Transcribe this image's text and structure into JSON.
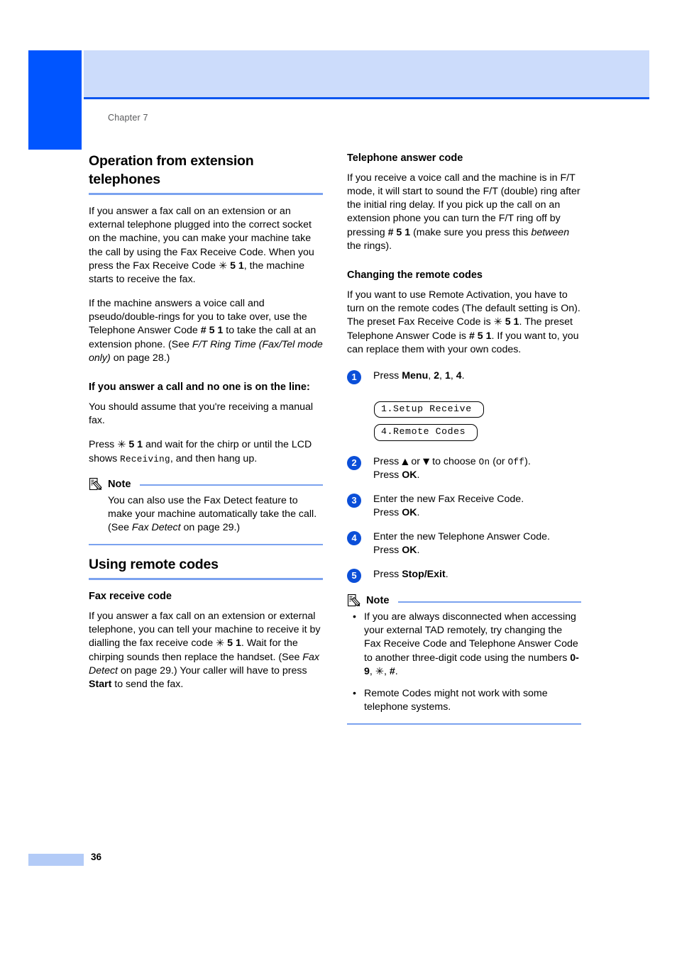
{
  "page": {
    "chapter_label": "Chapter 7",
    "page_number": "36",
    "accent_dark_blue": "#0055ff",
    "accent_banner_blue": "#ccdcfb",
    "accent_rule_blue": "#7ba2ef",
    "step_circle_blue": "#0b4fd8"
  },
  "left_column": {
    "section_title": "Operation from extension telephones",
    "paragraph_1_a": "If you answer a fax call on an extension or an external telephone plugged into the correct socket on the machine, you can make your machine take the call by using the Fax Receive Code. When you press the Fax Receive Code ",
    "paragraph_1_star": "✳",
    "paragraph_1_code": "5 1",
    "paragraph_1_b": ", the machine starts to receive the fax.",
    "paragraph_2_a": "If the machine answers a voice call and pseudo/double-rings for you to take over, use the Telephone Answer Code ",
    "paragraph_2_code": "# 5 1",
    "paragraph_2_b": " to take the call at an extension phone. (See ",
    "paragraph_2_italic": "F/T Ring Time (Fax/Tel mode only)",
    "paragraph_2_c": " on page 28.)",
    "sub_title_1": "If you answer a call and no one is on the line:",
    "paragraph_3": "You should assume that you're receiving a manual fax.",
    "paragraph_4_a": "Press ",
    "paragraph_4_star": "✳",
    "paragraph_4_code": "5 1",
    "paragraph_4_b": " and wait for the chirp or until the LCD shows ",
    "paragraph_4_lcd": "Receiving",
    "paragraph_4_c": ", and then hang up.",
    "note": {
      "title": "Note",
      "icon": "note-pencil-icon",
      "body_a": "You can also use the Fax Detect feature to make your machine automatically take the call. (See ",
      "body_italic": "Fax Detect",
      "body_b": " on page 29.)"
    },
    "section_title_2": "Using remote codes",
    "sub_title_2": "Fax receive code",
    "paragraph_5_a": "If you answer a fax call on an extension or external telephone, you can tell your machine to receive it by dialling the fax receive code ",
    "paragraph_5_star": "✳",
    "paragraph_5_code": "5 1",
    "paragraph_5_b": ". Wait for the chirping sounds then replace the handset. (See ",
    "paragraph_5_italic": "Fax Detect",
    "paragraph_5_c": " on page 29.) Your caller will have to press ",
    "paragraph_5_bold": "Start",
    "paragraph_5_d": " to send the fax."
  },
  "right_column": {
    "sub_title_1": "Telephone answer code",
    "paragraph_1_a": "If you receive a voice call and the machine is in F/T mode, it will start to sound the F/T (double) ring after the initial ring delay. If you pick up the call on an extension phone you can turn the F/T ring off by pressing ",
    "paragraph_1_code": "# 5 1",
    "paragraph_1_b": " (make sure you press this ",
    "paragraph_1_italic": "between",
    "paragraph_1_c": " the rings).",
    "sub_title_2": "Changing the remote codes",
    "paragraph_2_a": "If you want to use Remote Activation, you have to turn on the remote codes (The default setting is On). The preset Fax Receive Code is ",
    "paragraph_2_star": "✳",
    "paragraph_2_code1": "5 1",
    "paragraph_2_b": ". The preset Telephone Answer Code is ",
    "paragraph_2_code2": "# 5 1",
    "paragraph_2_c": ". If you want to, you can replace them with your own codes.",
    "steps": [
      {
        "num": "1",
        "text_a": "Press ",
        "bold_1": "Menu",
        "text_b": ", ",
        "bold_2": "2",
        "text_c": ", ",
        "bold_3": "1",
        "text_d": ", ",
        "bold_4": "4",
        "text_e": ".",
        "lcd_1": "1.Setup Receive",
        "lcd_2": "4.Remote Codes"
      },
      {
        "num": "2",
        "text_a": "Press ",
        "arrow_up": "▲",
        "text_b": " or ",
        "arrow_down": "▼",
        "text_c": " to choose ",
        "lcd_on": "On",
        "text_d": " (or ",
        "lcd_off": "Off",
        "text_e": ").",
        "text_f": "Press ",
        "bold_ok": "OK",
        "text_g": "."
      },
      {
        "num": "3",
        "text_a": "Enter the new Fax Receive Code.",
        "text_f": "Press ",
        "bold_ok": "OK",
        "text_g": "."
      },
      {
        "num": "4",
        "text_a": "Enter the new Telephone Answer Code.",
        "text_f": "Press ",
        "bold_ok": "OK",
        "text_g": "."
      },
      {
        "num": "5",
        "text_a": "Press ",
        "bold_stop": "Stop/Exit",
        "text_g": "."
      }
    ],
    "note": {
      "title": "Note",
      "icon": "note-pencil-icon",
      "bullet_1_a": "If you are always disconnected when accessing your external TAD remotely, try changing the Fax Receive Code and Telephone Answer Code to another three-digit code using the numbers ",
      "bullet_1_bold": "0-9",
      "bullet_1_b": ", ",
      "bullet_1_star": "✳",
      "bullet_1_c": ", ",
      "bullet_1_hash": "#",
      "bullet_1_d": ".",
      "bullet_2": "Remote Codes might not work with some telephone systems.",
      "bullet_char": "•"
    }
  }
}
